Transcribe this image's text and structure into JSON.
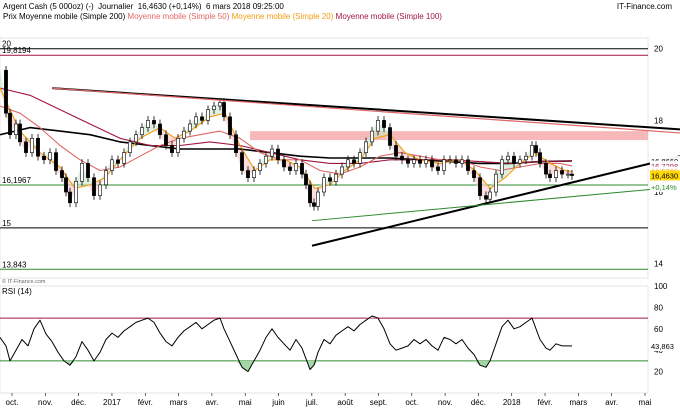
{
  "header": {
    "instrument": "Argent Cash (5 000oz) (-)",
    "period": "Journalier",
    "last_quote": "16,4630 (+0,14%)",
    "datetime": "6 mars 2018 09:25:00",
    "source": "IT-Finance.com",
    "copyright": "© IT-Finance.com"
  },
  "legend": [
    {
      "label": "Prix",
      "color": "#000000"
    },
    {
      "label": "Moyenne mobile (Simple 200)",
      "color": "#000000"
    },
    {
      "label": "Moyenne mobile (Simple 50)",
      "color": "#e06666"
    },
    {
      "label": "Moyenne mobile (Simple 20)",
      "color": "#f39c12"
    },
    {
      "label": "Moyenne mobile (Simple 100)",
      "color": "#a0153e"
    }
  ],
  "chart_data": [
    {
      "type": "candlestick",
      "title": "Argent Cash (5 000oz) (-)",
      "x_labels": [
        "oct.",
        "nov.",
        "déc.",
        "2017",
        "févr.",
        "mars",
        "avr.",
        "mai",
        "juin",
        "juil.",
        "août",
        "sept.",
        "oct.",
        "nov.",
        "déc.",
        "2018",
        "févr.",
        "mars",
        "avr.",
        "mai"
      ],
      "y_ticks": [
        14,
        16,
        18,
        20
      ],
      "ylim": [
        13.6,
        20.3
      ],
      "horizontal_levels": [
        {
          "value": 19.8194,
          "label": "19,8194",
          "color": "#a0153e"
        },
        {
          "value": 16.1967,
          "label": "16,1967",
          "color": "#2e8b2e"
        },
        {
          "value": 15,
          "label": "15",
          "color": "#000000"
        },
        {
          "value": 13.843,
          "label": "13,843",
          "color": "#2e8b2e"
        },
        {
          "value": 20,
          "label": "20",
          "color": "#000000"
        }
      ],
      "resistance_zone": {
        "low": 17.45,
        "high": 17.7,
        "color": "#f4a6a6"
      },
      "price_labels": [
        {
          "value": 16.866,
          "text": "16,8660",
          "color": "#000000"
        },
        {
          "value": 16.7298,
          "text": "16,7298",
          "color": "#a0153e"
        },
        {
          "value": 16.5735,
          "text": "16,5735",
          "color": "#f39c12"
        },
        {
          "value": 16.463,
          "text": "16,4630",
          "color": "#000000"
        },
        {
          "value": 16.14,
          "text": "+0,14%",
          "color": "#2e8b2e"
        }
      ],
      "price_series": [
        [
          0,
          19.4
        ],
        [
          6,
          18.2
        ],
        [
          10,
          17.6
        ],
        [
          16,
          17.9
        ],
        [
          20,
          17.4
        ],
        [
          26,
          17.1
        ],
        [
          32,
          17.5
        ],
        [
          38,
          17.0
        ],
        [
          44,
          16.9
        ],
        [
          50,
          17.1
        ],
        [
          56,
          16.6
        ],
        [
          62,
          16.4
        ],
        [
          66,
          16.0
        ],
        [
          70,
          15.7
        ],
        [
          76,
          16.3
        ],
        [
          82,
          16.8
        ],
        [
          88,
          16.4
        ],
        [
          94,
          15.9
        ],
        [
          100,
          16.2
        ],
        [
          106,
          16.6
        ],
        [
          112,
          16.9
        ],
        [
          118,
          16.8
        ],
        [
          124,
          17.1
        ],
        [
          130,
          17.4
        ],
        [
          136,
          17.6
        ],
        [
          142,
          17.8
        ],
        [
          148,
          18.0
        ],
        [
          154,
          17.9
        ],
        [
          160,
          17.6
        ],
        [
          166,
          17.3
        ],
        [
          172,
          17.1
        ],
        [
          178,
          17.5
        ],
        [
          184,
          17.7
        ],
        [
          190,
          17.9
        ],
        [
          196,
          18.1
        ],
        [
          202,
          18.0
        ],
        [
          208,
          18.3
        ],
        [
          214,
          18.4
        ],
        [
          220,
          18.5
        ],
        [
          224,
          18.1
        ],
        [
          230,
          17.6
        ],
        [
          236,
          17.1
        ],
        [
          242,
          16.6
        ],
        [
          248,
          16.4
        ],
        [
          254,
          16.6
        ],
        [
          260,
          16.8
        ],
        [
          266,
          17.0
        ],
        [
          272,
          17.2
        ],
        [
          278,
          16.9
        ],
        [
          284,
          16.7
        ],
        [
          290,
          16.6
        ],
        [
          296,
          16.8
        ],
        [
          302,
          16.5
        ],
        [
          306,
          16.2
        ],
        [
          310,
          15.7
        ],
        [
          314,
          15.6
        ],
        [
          318,
          16.0
        ],
        [
          324,
          16.4
        ],
        [
          330,
          16.3
        ],
        [
          336,
          16.5
        ],
        [
          342,
          16.7
        ],
        [
          348,
          16.9
        ],
        [
          354,
          16.8
        ],
        [
          360,
          17.1
        ],
        [
          366,
          17.4
        ],
        [
          372,
          17.7
        ],
        [
          378,
          18.0
        ],
        [
          384,
          17.8
        ],
        [
          390,
          17.3
        ],
        [
          396,
          17.0
        ],
        [
          402,
          16.9
        ],
        [
          408,
          16.8
        ],
        [
          414,
          16.9
        ],
        [
          420,
          16.8
        ],
        [
          426,
          16.9
        ],
        [
          432,
          16.7
        ],
        [
          438,
          16.6
        ],
        [
          444,
          16.9
        ],
        [
          450,
          16.9
        ],
        [
          456,
          16.8
        ],
        [
          462,
          16.9
        ],
        [
          468,
          16.6
        ],
        [
          474,
          16.4
        ],
        [
          480,
          15.9
        ],
        [
          486,
          15.8
        ],
        [
          490,
          16.0
        ],
        [
          496,
          16.5
        ],
        [
          502,
          16.9
        ],
        [
          508,
          17.0
        ],
        [
          514,
          16.8
        ],
        [
          520,
          16.9
        ],
        [
          526,
          17.0
        ],
        [
          532,
          17.3
        ],
        [
          536,
          17.1
        ],
        [
          540,
          16.8
        ],
        [
          546,
          16.5
        ],
        [
          550,
          16.4
        ],
        [
          556,
          16.6
        ],
        [
          562,
          16.5
        ],
        [
          568,
          16.5
        ],
        [
          572,
          16.46
        ]
      ],
      "ma20_series": [
        [
          0,
          18.9
        ],
        [
          20,
          17.7
        ],
        [
          40,
          17.1
        ],
        [
          60,
          16.7
        ],
        [
          75,
          16.1
        ],
        [
          90,
          16.2
        ],
        [
          105,
          16.4
        ],
        [
          120,
          16.9
        ],
        [
          140,
          17.5
        ],
        [
          160,
          17.8
        ],
        [
          175,
          17.5
        ],
        [
          190,
          17.7
        ],
        [
          210,
          18.1
        ],
        [
          225,
          18.2
        ],
        [
          240,
          17.3
        ],
        [
          255,
          16.6
        ],
        [
          270,
          16.9
        ],
        [
          285,
          16.9
        ],
        [
          300,
          16.7
        ],
        [
          315,
          16.1
        ],
        [
          330,
          16.2
        ],
        [
          345,
          16.6
        ],
        [
          360,
          16.9
        ],
        [
          375,
          17.5
        ],
        [
          390,
          17.6
        ],
        [
          405,
          17.1
        ],
        [
          420,
          16.9
        ],
        [
          440,
          16.8
        ],
        [
          460,
          16.9
        ],
        [
          475,
          16.6
        ],
        [
          490,
          16.1
        ],
        [
          505,
          16.4
        ],
        [
          520,
          16.8
        ],
        [
          535,
          17.1
        ],
        [
          550,
          16.8
        ],
        [
          565,
          16.6
        ],
        [
          572,
          16.57
        ]
      ],
      "ma50_series": [
        [
          0,
          18.4
        ],
        [
          20,
          18.2
        ],
        [
          40,
          17.8
        ],
        [
          60,
          17.3
        ],
        [
          80,
          16.9
        ],
        [
          100,
          16.6
        ],
        [
          120,
          16.7
        ],
        [
          140,
          17.0
        ],
        [
          160,
          17.3
        ],
        [
          180,
          17.5
        ],
        [
          200,
          17.6
        ],
        [
          220,
          17.7
        ],
        [
          240,
          17.5
        ],
        [
          260,
          17.1
        ],
        [
          280,
          16.9
        ],
        [
          300,
          16.9
        ],
        [
          320,
          16.6
        ],
        [
          340,
          16.5
        ],
        [
          360,
          16.7
        ],
        [
          380,
          17.0
        ],
        [
          400,
          17.1
        ],
        [
          420,
          17.0
        ],
        [
          440,
          16.9
        ],
        [
          460,
          16.9
        ],
        [
          480,
          16.7
        ],
        [
          500,
          16.6
        ],
        [
          520,
          16.7
        ],
        [
          540,
          16.8
        ],
        [
          560,
          16.8
        ],
        [
          572,
          16.73
        ]
      ],
      "ma100_series": [
        [
          0,
          18.9
        ],
        [
          30,
          18.7
        ],
        [
          60,
          18.3
        ],
        [
          90,
          17.9
        ],
        [
          120,
          17.5
        ],
        [
          150,
          17.3
        ],
        [
          180,
          17.3
        ],
        [
          210,
          17.4
        ],
        [
          240,
          17.3
        ],
        [
          270,
          17.1
        ],
        [
          300,
          16.9
        ],
        [
          330,
          16.8
        ],
        [
          360,
          16.8
        ],
        [
          390,
          16.9
        ],
        [
          420,
          16.9
        ],
        [
          450,
          16.9
        ],
        [
          480,
          16.85
        ],
        [
          510,
          16.8
        ],
        [
          540,
          16.85
        ],
        [
          572,
          16.87
        ]
      ],
      "ma200_series": [
        [
          0,
          17.6
        ],
        [
          30,
          17.8
        ],
        [
          60,
          17.7
        ],
        [
          90,
          17.6
        ],
        [
          120,
          17.4
        ],
        [
          150,
          17.3
        ],
        [
          180,
          17.2
        ],
        [
          210,
          17.2
        ],
        [
          240,
          17.2
        ],
        [
          270,
          17.1
        ],
        [
          300,
          17.0
        ],
        [
          330,
          16.95
        ],
        [
          360,
          16.95
        ],
        [
          390,
          16.95
        ],
        [
          420,
          16.9
        ],
        [
          450,
          16.85
        ],
        [
          480,
          16.8
        ],
        [
          510,
          16.8
        ],
        [
          540,
          16.85
        ],
        [
          572,
          16.87
        ]
      ],
      "trendlines": [
        {
          "from": [
            52,
            18.9
          ],
          "to": [
            680,
            17.75
          ],
          "color": "#000000",
          "width": 2
        },
        {
          "from": [
            52,
            18.9
          ],
          "to": [
            680,
            17.65
          ],
          "color": "#e06666",
          "width": 1.2
        },
        {
          "from": [
            312,
            14.5
          ],
          "to": [
            680,
            17.0
          ],
          "color": "#000000",
          "width": 2
        },
        {
          "from": [
            312,
            15.2
          ],
          "to": [
            680,
            16.15
          ],
          "color": "#2e8b2e",
          "width": 1
        }
      ]
    },
    {
      "type": "line",
      "title": "RSI (14)",
      "y_ticks": [
        20,
        40,
        60,
        80,
        100
      ],
      "ylim": [
        0,
        100
      ],
      "overbought": 70,
      "oversold": 30,
      "last_value": 43.863,
      "last_label": "43,863",
      "series": [
        [
          0,
          52
        ],
        [
          6,
          44
        ],
        [
          10,
          30
        ],
        [
          16,
          40
        ],
        [
          22,
          50
        ],
        [
          28,
          44
        ],
        [
          34,
          60
        ],
        [
          40,
          68
        ],
        [
          46,
          55
        ],
        [
          52,
          48
        ],
        [
          58,
          38
        ],
        [
          64,
          30
        ],
        [
          70,
          26
        ],
        [
          76,
          34
        ],
        [
          82,
          48
        ],
        [
          88,
          40
        ],
        [
          94,
          30
        ],
        [
          100,
          38
        ],
        [
          106,
          50
        ],
        [
          112,
          56
        ],
        [
          118,
          52
        ],
        [
          124,
          58
        ],
        [
          130,
          62
        ],
        [
          136,
          66
        ],
        [
          142,
          68
        ],
        [
          148,
          70
        ],
        [
          154,
          66
        ],
        [
          160,
          56
        ],
        [
          166,
          48
        ],
        [
          172,
          44
        ],
        [
          178,
          52
        ],
        [
          184,
          58
        ],
        [
          190,
          62
        ],
        [
          196,
          66
        ],
        [
          202,
          60
        ],
        [
          208,
          64
        ],
        [
          214,
          68
        ],
        [
          220,
          70
        ],
        [
          224,
          60
        ],
        [
          230,
          48
        ],
        [
          236,
          36
        ],
        [
          242,
          24
        ],
        [
          248,
          20
        ],
        [
          254,
          30
        ],
        [
          260,
          40
        ],
        [
          266,
          52
        ],
        [
          272,
          60
        ],
        [
          278,
          52
        ],
        [
          284,
          46
        ],
        [
          290,
          40
        ],
        [
          296,
          50
        ],
        [
          302,
          42
        ],
        [
          306,
          32
        ],
        [
          310,
          22
        ],
        [
          314,
          26
        ],
        [
          318,
          38
        ],
        [
          324,
          50
        ],
        [
          330,
          46
        ],
        [
          336,
          54
        ],
        [
          342,
          58
        ],
        [
          348,
          62
        ],
        [
          354,
          58
        ],
        [
          360,
          64
        ],
        [
          366,
          68
        ],
        [
          372,
          72
        ],
        [
          378,
          70
        ],
        [
          384,
          60
        ],
        [
          390,
          46
        ],
        [
          396,
          40
        ],
        [
          402,
          42
        ],
        [
          408,
          44
        ],
        [
          414,
          50
        ],
        [
          420,
          46
        ],
        [
          426,
          50
        ],
        [
          432,
          44
        ],
        [
          438,
          40
        ],
        [
          444,
          52
        ],
        [
          450,
          50
        ],
        [
          456,
          46
        ],
        [
          462,
          50
        ],
        [
          468,
          42
        ],
        [
          474,
          36
        ],
        [
          480,
          26
        ],
        [
          486,
          24
        ],
        [
          490,
          30
        ],
        [
          496,
          46
        ],
        [
          502,
          62
        ],
        [
          508,
          68
        ],
        [
          514,
          60
        ],
        [
          520,
          62
        ],
        [
          526,
          66
        ],
        [
          532,
          70
        ],
        [
          536,
          60
        ],
        [
          540,
          50
        ],
        [
          546,
          42
        ],
        [
          550,
          40
        ],
        [
          556,
          46
        ],
        [
          562,
          44
        ],
        [
          568,
          44
        ],
        [
          572,
          43.9
        ]
      ]
    }
  ]
}
